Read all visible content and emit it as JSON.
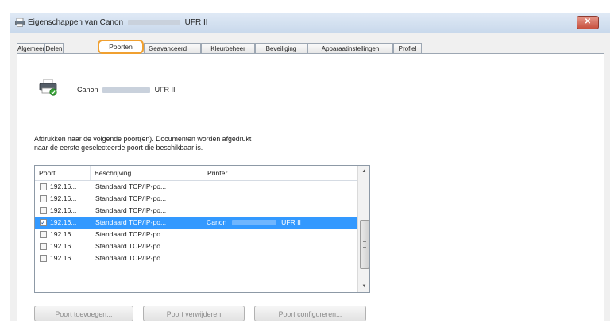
{
  "window": {
    "title_prefix": "Eigenschappen van Canon",
    "title_suffix": "UFR II",
    "close_label": "✕"
  },
  "tabs": [
    {
      "label": "Algemeen"
    },
    {
      "label": "Delen"
    },
    {
      "label": "Poorten",
      "active": true
    },
    {
      "label": "Geavanceerd"
    },
    {
      "label": "Kleurbeheer"
    },
    {
      "label": "Beveiliging"
    },
    {
      "label": "Apparaatinstellingen"
    },
    {
      "label": "Profiel"
    }
  ],
  "printer": {
    "brand": "Canon",
    "model_suffix": "UFR II"
  },
  "description_line1": "Afdrukken naar de volgende poort(en). Documenten worden afgedrukt",
  "description_line2": "naar de eerste geselecteerde poort die beschikbaar is.",
  "columns": {
    "port": "Poort",
    "description": "Beschrijving",
    "printer": "Printer"
  },
  "rows": [
    {
      "port": "192.16...",
      "description": "Standaard TCP/IP-po...",
      "printer": "",
      "checked": false
    },
    {
      "port": "192.16...",
      "description": "Standaard TCP/IP-po...",
      "printer": "",
      "checked": false
    },
    {
      "port": "192.16...",
      "description": "Standaard TCP/IP-po...",
      "printer": "",
      "checked": false
    },
    {
      "port": "192.16...",
      "description": "Standaard TCP/IP-po...",
      "printer_brand": "Canon",
      "printer_suffix": "UFR II",
      "checked": true,
      "selected": true
    },
    {
      "port": "192.16...",
      "description": "Standaard TCP/IP-po...",
      "printer": "",
      "checked": false
    },
    {
      "port": "192.16...",
      "description": "Standaard TCP/IP-po...",
      "printer": "",
      "checked": false
    },
    {
      "port": "192.16...",
      "description": "Standaard TCP/IP-po...",
      "printer": "",
      "checked": false
    }
  ],
  "buttons": {
    "add": "Poort toevoegen...",
    "remove": "Poort verwijderen",
    "configure": "Poort configureren..."
  },
  "colors": {
    "selection": "#3399ff",
    "tab_highlight": "#f0a030"
  }
}
